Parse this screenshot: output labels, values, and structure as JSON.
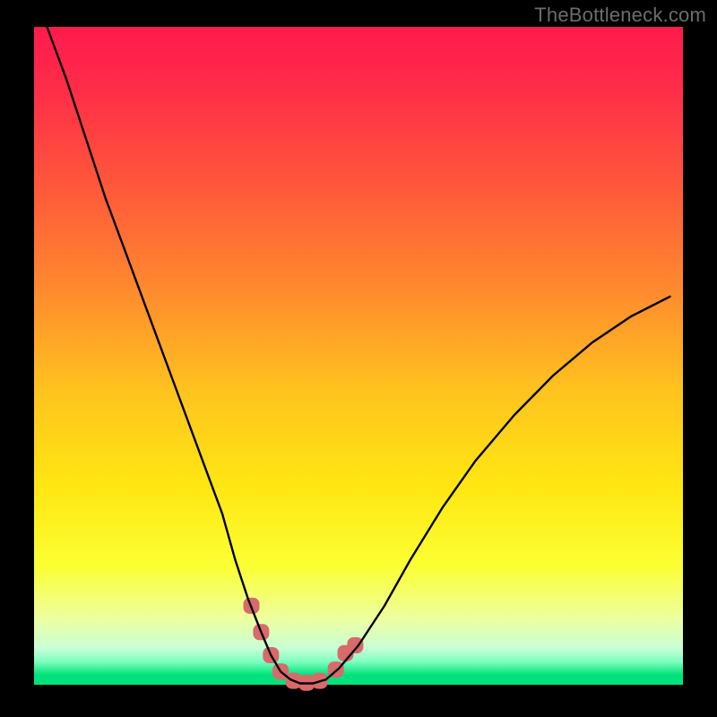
{
  "watermark": "TheBottleneck.com",
  "colors": {
    "frame": "#000000",
    "curve": "#000000",
    "marker": "#d86a6a",
    "green_bottom": "#00e27a",
    "gradient_stops": [
      {
        "offset": 0.0,
        "color": "#ff1a4d"
      },
      {
        "offset": 0.1,
        "color": "#ff2e48"
      },
      {
        "offset": 0.25,
        "color": "#ff5a3a"
      },
      {
        "offset": 0.4,
        "color": "#ff8a2e"
      },
      {
        "offset": 0.55,
        "color": "#ffc21f"
      },
      {
        "offset": 0.7,
        "color": "#ffe712"
      },
      {
        "offset": 0.82,
        "color": "#fbff33"
      },
      {
        "offset": 0.9,
        "color": "#edffa1"
      },
      {
        "offset": 0.945,
        "color": "#c7ffd6"
      },
      {
        "offset": 0.965,
        "color": "#7dffc0"
      },
      {
        "offset": 0.985,
        "color": "#00e27a"
      },
      {
        "offset": 1.0,
        "color": "#00e27a"
      }
    ]
  },
  "layout": {
    "outer_w": 800,
    "outer_h": 800,
    "inner_x": 38,
    "inner_y": 30,
    "inner_w": 724,
    "inner_h": 734
  },
  "chart_data": {
    "type": "line",
    "title": "",
    "xlabel": "",
    "ylabel": "",
    "xlim": [
      0,
      100
    ],
    "ylim": [
      0,
      100
    ],
    "note": "Bottleneck-style V curve; y≈0 is optimal (green band), y≈100 is worst (red).",
    "series": [
      {
        "name": "bottleneck-curve",
        "x": [
          2,
          5,
          8,
          11,
          14,
          17,
          20,
          23,
          26,
          29,
          31,
          33,
          35,
          36.5,
          38,
          39.5,
          41,
          43,
          45,
          47,
          50,
          54,
          58,
          63,
          68,
          74,
          80,
          86,
          92,
          98
        ],
        "y": [
          100,
          92,
          83,
          74,
          66,
          58,
          50,
          42,
          34,
          26,
          19,
          13,
          8,
          4.5,
          2,
          0.8,
          0.2,
          0.2,
          0.8,
          2.5,
          6,
          12,
          19,
          27,
          34,
          41,
          47,
          52,
          56,
          59
        ]
      }
    ],
    "markers": {
      "name": "highlighted-points",
      "x": [
        33.5,
        35,
        36.5,
        38,
        40,
        42,
        44,
        46.5,
        48,
        49.5
      ],
      "y": [
        12,
        8,
        4.5,
        2,
        0.6,
        0.3,
        0.6,
        2.3,
        4.8,
        6.0
      ]
    }
  }
}
